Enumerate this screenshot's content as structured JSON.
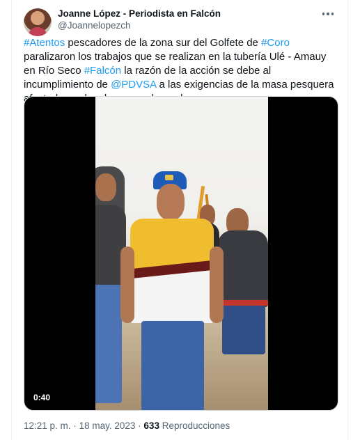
{
  "tweet": {
    "author_name": "Joanne López - Periodista en Falcón",
    "author_handle": "@Joannelopezch",
    "text_segments": [
      {
        "text": "#Atentos",
        "type": "hashtag"
      },
      {
        "text": " pescadores de la zona sur del Golfete de ",
        "type": "plain"
      },
      {
        "text": "#Coro",
        "type": "hashtag"
      },
      {
        "text": " paralizaron los trabajos que se realizan  en la tubería Ulé - Amauy  en Río Seco ",
        "type": "plain"
      },
      {
        "text": "#Falcón",
        "type": "hashtag"
      },
      {
        "text": " la razón de la acción se debe al incumplimiento de ",
        "type": "plain"
      },
      {
        "text": "@PDVSA",
        "type": "mention"
      },
      {
        "text": " a las exigencias de la masa pesquera  afectada por los derrames de crudo",
        "type": "plain"
      }
    ],
    "video": {
      "duration": "0:40",
      "icon": "video-player"
    },
    "time": "12:21 p. m.",
    "separator": "·",
    "date": "18 may. 2023",
    "views_count": "633",
    "views_label": "Reproducciones"
  },
  "colors": {
    "link": "#1d9bf0",
    "text": "#0f1419",
    "secondary": "#536471",
    "border": "#cfd9de"
  }
}
